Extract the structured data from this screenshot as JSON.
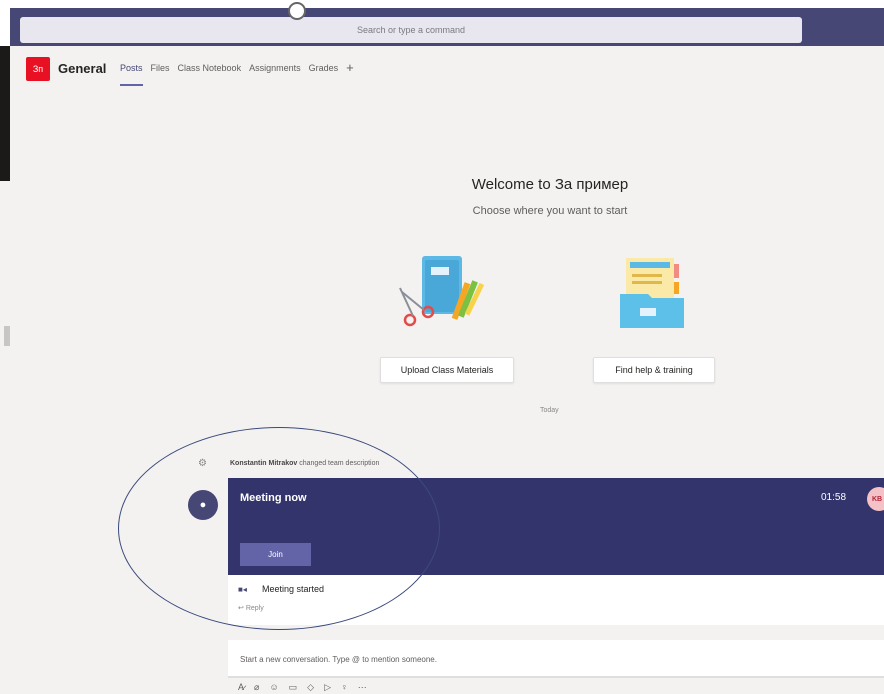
{
  "search": {
    "placeholder": "Search or type a command"
  },
  "channel": {
    "team_logo_initials": "Зп",
    "name": "General",
    "tabs": [
      {
        "label": "Posts",
        "active": true
      },
      {
        "label": "Files"
      },
      {
        "label": "Class Notebook"
      },
      {
        "label": "Assignments"
      },
      {
        "label": "Grades"
      }
    ],
    "add_tab_label": "+"
  },
  "welcome": {
    "title": "Welcome to За пример",
    "subtitle": "Choose where you want to start",
    "upload_button": "Upload Class Materials",
    "help_button": "Find help & training"
  },
  "feed": {
    "today_label": "Today",
    "activity": {
      "actor": "Konstantin Mitrakov",
      "action": " changed team description"
    },
    "meeting": {
      "title": "Meeting now",
      "time": "01:58",
      "attendee_initials": "KB",
      "join_label": "Join",
      "status": "Meeting started",
      "reply_label": "Reply"
    }
  },
  "compose": {
    "placeholder": "Start a new conversation. Type @ to mention someone.",
    "tools": [
      "format-icon",
      "attach-icon",
      "emoji-icon",
      "gif-icon",
      "sticker-icon",
      "meet-icon",
      "praise-icon",
      "more-icon"
    ]
  },
  "colors": {
    "accent": "#6264a7",
    "header": "#464775",
    "meeting_card": "#33346b",
    "brand_red": "#e81123"
  }
}
